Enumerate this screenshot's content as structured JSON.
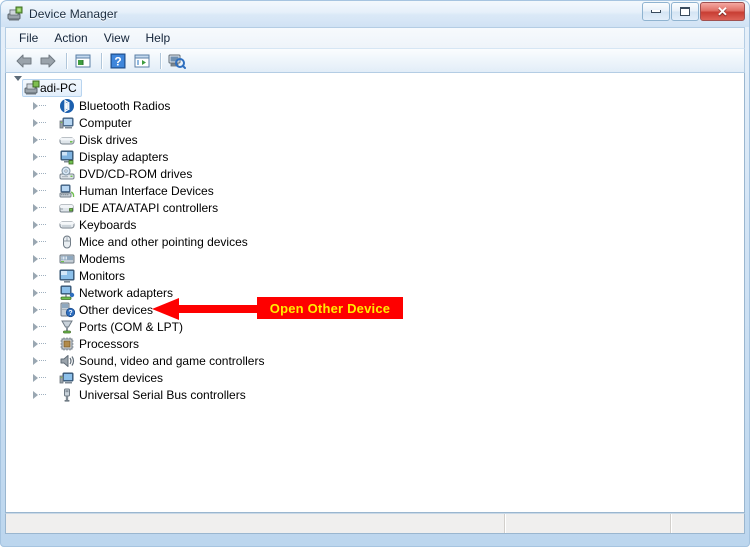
{
  "window": {
    "title": "Device Manager",
    "icon": "device-manager-icon",
    "buttons": {
      "minimize": "minimize-button",
      "maximize": "maximize-button",
      "close": "close-button",
      "close_glyph": "✕"
    }
  },
  "menubar": {
    "items": [
      {
        "label": "File",
        "name": "menu-file"
      },
      {
        "label": "Action",
        "name": "menu-action"
      },
      {
        "label": "View",
        "name": "menu-view"
      },
      {
        "label": "Help",
        "name": "menu-help"
      }
    ]
  },
  "toolbar": {
    "items": [
      {
        "name": "back-icon",
        "title": "Back"
      },
      {
        "name": "forward-icon",
        "title": "Forward"
      },
      {
        "name": "separator-1",
        "title": ""
      },
      {
        "name": "show-hide-console-tree-icon",
        "title": "Show/Hide Console Tree"
      },
      {
        "name": "separator-2",
        "title": ""
      },
      {
        "name": "help-icon",
        "title": "Help"
      },
      {
        "name": "properties-icon",
        "title": "Properties"
      },
      {
        "name": "separator-3",
        "title": ""
      },
      {
        "name": "scan-for-hardware-changes-icon",
        "title": "Scan for hardware changes"
      }
    ]
  },
  "tree": {
    "root": {
      "label": "adi-PC",
      "icon": "computer-icon",
      "expanded": true,
      "selected": true
    },
    "nodes": [
      {
        "label": "Bluetooth Radios",
        "icon": "bluetooth-icon"
      },
      {
        "label": "Computer",
        "icon": "computer-node-icon"
      },
      {
        "label": "Disk drives",
        "icon": "disk-drive-icon"
      },
      {
        "label": "Display adapters",
        "icon": "display-adapter-icon"
      },
      {
        "label": "DVD/CD-ROM drives",
        "icon": "dvd-drive-icon"
      },
      {
        "label": "Human Interface Devices",
        "icon": "hid-icon"
      },
      {
        "label": "IDE ATA/ATAPI controllers",
        "icon": "ide-controller-icon"
      },
      {
        "label": "Keyboards",
        "icon": "keyboard-icon"
      },
      {
        "label": "Mice and other pointing devices",
        "icon": "mouse-icon"
      },
      {
        "label": "Modems",
        "icon": "modem-icon"
      },
      {
        "label": "Monitors",
        "icon": "monitor-icon"
      },
      {
        "label": "Network adapters",
        "icon": "network-adapter-icon"
      },
      {
        "label": "Other devices",
        "icon": "other-devices-icon"
      },
      {
        "label": "Ports (COM & LPT)",
        "icon": "ports-icon"
      },
      {
        "label": "Processors",
        "icon": "processor-icon"
      },
      {
        "label": "Sound, video and game controllers",
        "icon": "sound-controller-icon"
      },
      {
        "label": "System devices",
        "icon": "system-device-icon"
      },
      {
        "label": "Universal Serial Bus controllers",
        "icon": "usb-controller-icon"
      }
    ]
  },
  "annotation": {
    "text": "Open Other Device",
    "box_color": "#fe0000",
    "text_color": "#ffec00",
    "arrow_color": "#fe0000",
    "points_to": "Other devices"
  },
  "statusbar": {
    "text": ""
  }
}
